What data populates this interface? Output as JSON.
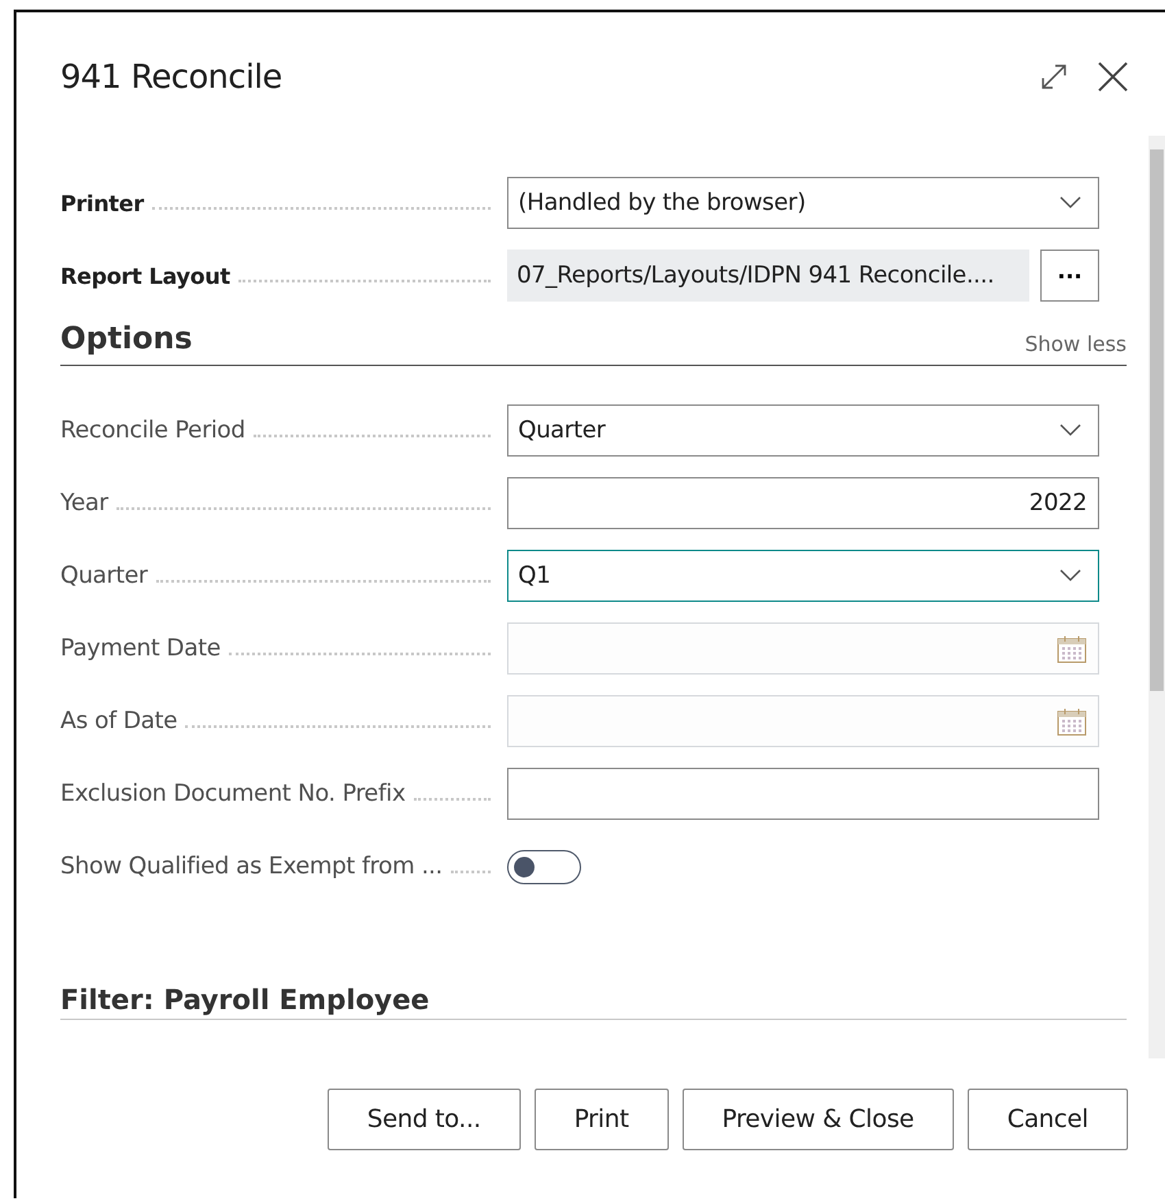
{
  "window": {
    "title": "941 Reconcile"
  },
  "general_fields": [
    {
      "kind": "dropdown",
      "label": "Printer",
      "value": "(Handled by the browser)",
      "focused": false,
      "disabled": false
    },
    {
      "kind": "lookup",
      "label": "Report Layout",
      "value": "07_Reports/Layouts/IDPN 941 Reconcile....",
      "button": "···"
    }
  ],
  "options": {
    "title": "Options",
    "toggle_link": "Show less",
    "fields": [
      {
        "kind": "dropdown",
        "label": "Reconcile Period",
        "value": "Quarter",
        "focused": false,
        "disabled": false
      },
      {
        "kind": "number",
        "label": "Year",
        "value": "2022",
        "focused": false,
        "disabled": false
      },
      {
        "kind": "dropdown",
        "label": "Quarter",
        "value": "Q1",
        "focused": true,
        "disabled": false
      },
      {
        "kind": "date",
        "label": "Payment Date",
        "focused": false,
        "disabled": true
      },
      {
        "kind": "date",
        "label": "As of Date",
        "focused": false,
        "disabled": true
      },
      {
        "kind": "text",
        "label": "Exclusion Document No. Prefix",
        "focused": false,
        "disabled": false
      },
      {
        "kind": "toggle",
        "label": "Show Qualified as Exempt from ...",
        "on": false
      }
    ]
  },
  "filter_section": {
    "title": "Filter: Payroll Employee"
  },
  "buttons": [
    "Send to...",
    "Print",
    "Preview & Close",
    "Cancel"
  ]
}
